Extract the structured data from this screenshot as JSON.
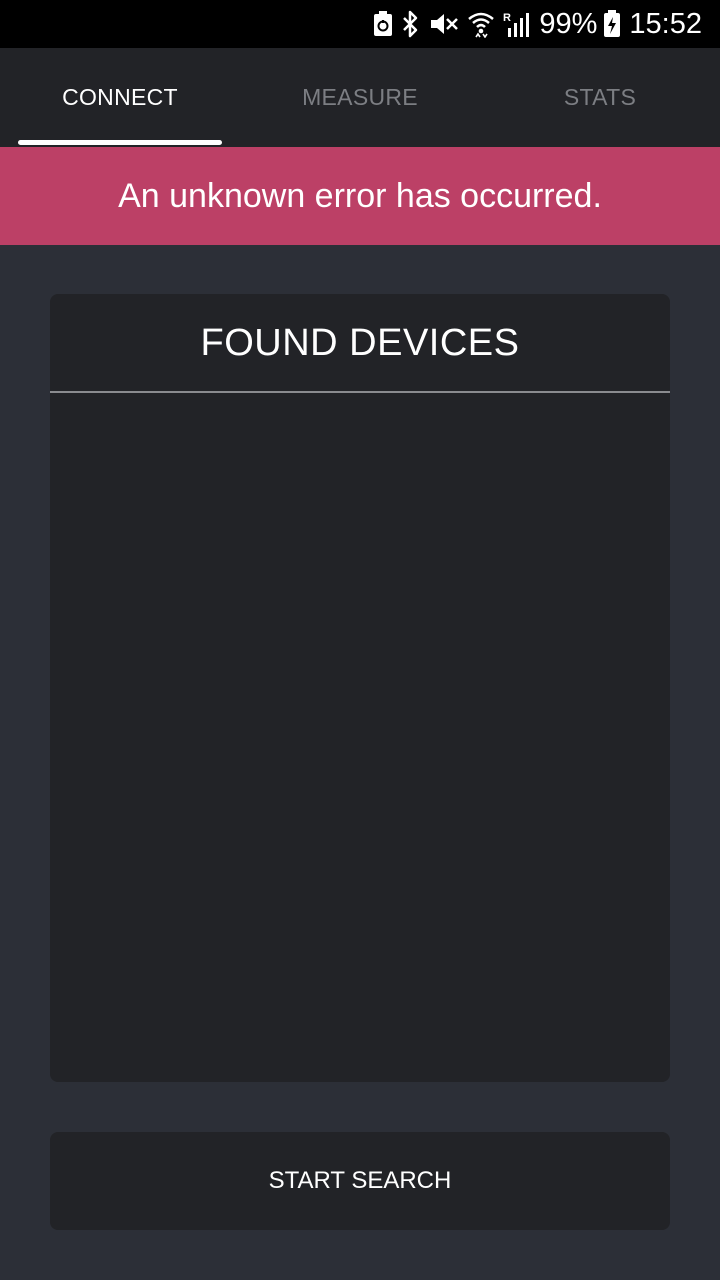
{
  "status_bar": {
    "battery_percent": "99%",
    "time": "15:52",
    "icons": [
      "battery-saver-icon",
      "bluetooth-icon",
      "mute-icon",
      "wifi-icon",
      "signal-icon",
      "battery-charging-icon"
    ]
  },
  "tabs": [
    {
      "label": "CONNECT",
      "active": true
    },
    {
      "label": "MEASURE",
      "active": false
    },
    {
      "label": "STATS",
      "active": false
    }
  ],
  "error": {
    "message": "An unknown error has occurred.",
    "color": "#bc4066"
  },
  "devices": {
    "title": "FOUND DEVICES",
    "items": []
  },
  "actions": {
    "start_search_label": "START SEARCH"
  },
  "colors": {
    "background": "#2c2f37",
    "panel": "#222327",
    "tab_inactive": "#7c7e83",
    "text": "#ffffff"
  }
}
